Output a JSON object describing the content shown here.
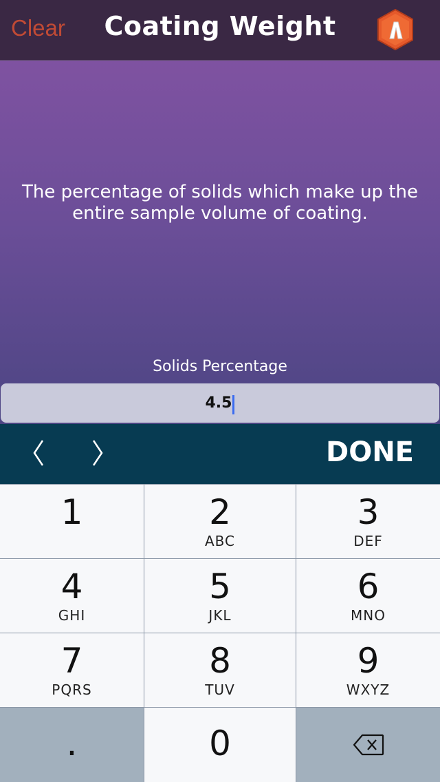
{
  "navbar": {
    "clear_label": "Clear",
    "title": "Coating Weight",
    "logo_icon": "brand-logo-icon",
    "clear_color": "#c04a35"
  },
  "main": {
    "description": "The percentage of solids which make up the entire sample volume of coating.",
    "field_label": "Solids Percentage",
    "field_value": "4.5",
    "gradient_top": "#7f52a1",
    "gradient_bottom": "#4c4583"
  },
  "toolbar": {
    "prev_icon": "chevron-left-icon",
    "next_icon": "chevron-right-icon",
    "done_label": "DONE",
    "background": "#073b52"
  },
  "keypad": {
    "keys": [
      {
        "num": "1",
        "letters": ""
      },
      {
        "num": "2",
        "letters": "ABC"
      },
      {
        "num": "3",
        "letters": "DEF"
      },
      {
        "num": "4",
        "letters": "GHI"
      },
      {
        "num": "5",
        "letters": "JKL"
      },
      {
        "num": "6",
        "letters": "MNO"
      },
      {
        "num": "7",
        "letters": "PQRS"
      },
      {
        "num": "8",
        "letters": "TUV"
      },
      {
        "num": "9",
        "letters": "WXYZ"
      }
    ],
    "decimal_label": ".",
    "zero_label": "0",
    "delete_icon": "backspace-icon"
  }
}
